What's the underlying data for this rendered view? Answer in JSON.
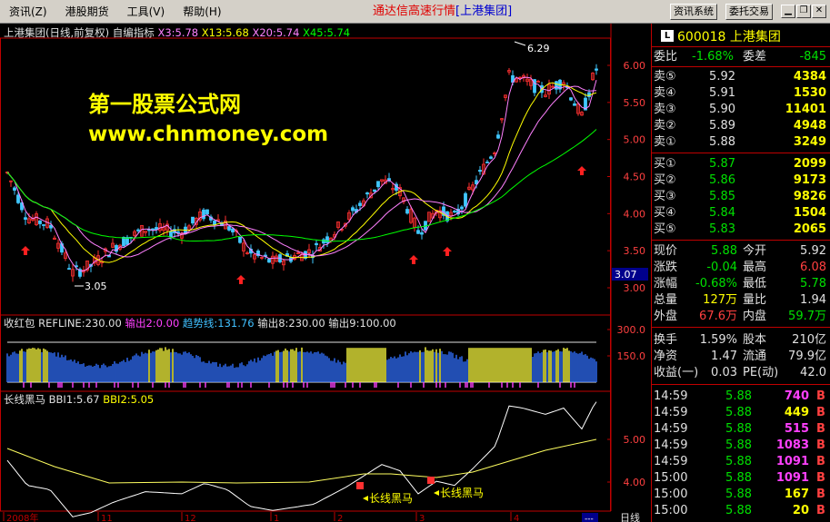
{
  "menu": {
    "items": [
      "资讯(Z)",
      "港股期货",
      "工具(V)",
      "帮助(H)"
    ],
    "title_left": "通达信高速行情",
    "title_right": "[上港集团]",
    "btn_news": "资讯系统",
    "btn_order": "委托交易"
  },
  "main": {
    "stock": "上港集团(日线,前复权)",
    "indicator": "自编指标",
    "ma": [
      {
        "label": "X3:5.78",
        "color": "#ff80ff"
      },
      {
        "label": "X13:5.68",
        "color": "#ffff00"
      },
      {
        "label": "X20:5.74",
        "color": "#ff80ff"
      },
      {
        "label": "X45:5.74",
        "color": "#00ff00"
      }
    ],
    "high_label": "6.29",
    "low_label": "3.05",
    "price_ticks": [
      "6.00",
      "5.50",
      "5.00",
      "4.50",
      "4.00",
      "3.50",
      "3.00"
    ],
    "cursor_price": "3.07"
  },
  "watermark": {
    "title": "第一股票公式网",
    "url": "www.chnmoney.com"
  },
  "sub1": {
    "name": "收红包",
    "refline": "REFLINE:230.00",
    "out2": "输出2:0.00",
    "trend": "趋势线:131.76",
    "out8": "输出8:230.00",
    "out9": "输出9:100.00",
    "ticks": [
      "300.0",
      "150.0"
    ]
  },
  "sub2": {
    "name": "长线黑马",
    "bbi1": "BBI1:5.67",
    "bbi2": "BBI2:5.05",
    "ticks": [
      "5.00",
      "4.00"
    ],
    "signal1": "长线黑马",
    "signal2": "长线黑马"
  },
  "timeline": {
    "labels": [
      "2008年",
      "11",
      "12",
      "1",
      "2",
      "3",
      "4"
    ],
    "period": "日线",
    "more": "---"
  },
  "quote": {
    "code": "600018",
    "name": "上港集团",
    "weibi_label": "委比",
    "weibi": "-1.68%",
    "weicha_label": "委差",
    "weicha": "-845",
    "sells": [
      {
        "l": "卖⑤",
        "p": "5.92",
        "v": "4384"
      },
      {
        "l": "卖④",
        "p": "5.91",
        "v": "1530"
      },
      {
        "l": "卖③",
        "p": "5.90",
        "v": "11401"
      },
      {
        "l": "卖②",
        "p": "5.89",
        "v": "4948"
      },
      {
        "l": "卖①",
        "p": "5.88",
        "v": "3249"
      }
    ],
    "buys": [
      {
        "l": "买①",
        "p": "5.87",
        "v": "2099"
      },
      {
        "l": "买②",
        "p": "5.86",
        "v": "9173"
      },
      {
        "l": "买③",
        "p": "5.85",
        "v": "9826"
      },
      {
        "l": "买④",
        "p": "5.84",
        "v": "1504"
      },
      {
        "l": "买⑤",
        "p": "5.83",
        "v": "2065"
      }
    ],
    "stats": [
      {
        "a": "现价",
        "b": "5.88",
        "c": "今开",
        "d": "5.92"
      },
      {
        "a": "涨跌",
        "b": "-0.04",
        "c": "最高",
        "d": "6.08"
      },
      {
        "a": "涨幅",
        "b": "-0.68%",
        "c": "最低",
        "d": "5.78"
      },
      {
        "a": "总量",
        "b": "127万",
        "c": "量比",
        "d": "1.94"
      },
      {
        "a": "外盘",
        "b": "67.6万",
        "c": "内盘",
        "d": "59.7万"
      }
    ],
    "stats2": [
      {
        "a": "换手",
        "b": "1.59%",
        "c": "股本",
        "d": "210亿"
      },
      {
        "a": "净资",
        "b": "1.47",
        "c": "流通",
        "d": "79.9亿"
      },
      {
        "a": "收益(一)",
        "b": "0.03",
        "c": "PE(动)",
        "d": "42.0"
      }
    ],
    "ticks": [
      {
        "t": "14:59",
        "p": "5.88",
        "v": "740",
        "s": "B"
      },
      {
        "t": "14:59",
        "p": "5.88",
        "v": "449",
        "s": "B"
      },
      {
        "t": "14:59",
        "p": "5.88",
        "v": "515",
        "s": "B"
      },
      {
        "t": "14:59",
        "p": "5.88",
        "v": "1083",
        "s": "B"
      },
      {
        "t": "14:59",
        "p": "5.88",
        "v": "1091",
        "s": "B"
      },
      {
        "t": "15:00",
        "p": "5.88",
        "v": "1091",
        "s": "B"
      },
      {
        "t": "15:00",
        "p": "5.88",
        "v": "167",
        "s": "B"
      },
      {
        "t": "15:00",
        "p": "5.88",
        "v": "20",
        "s": "B"
      }
    ]
  }
}
